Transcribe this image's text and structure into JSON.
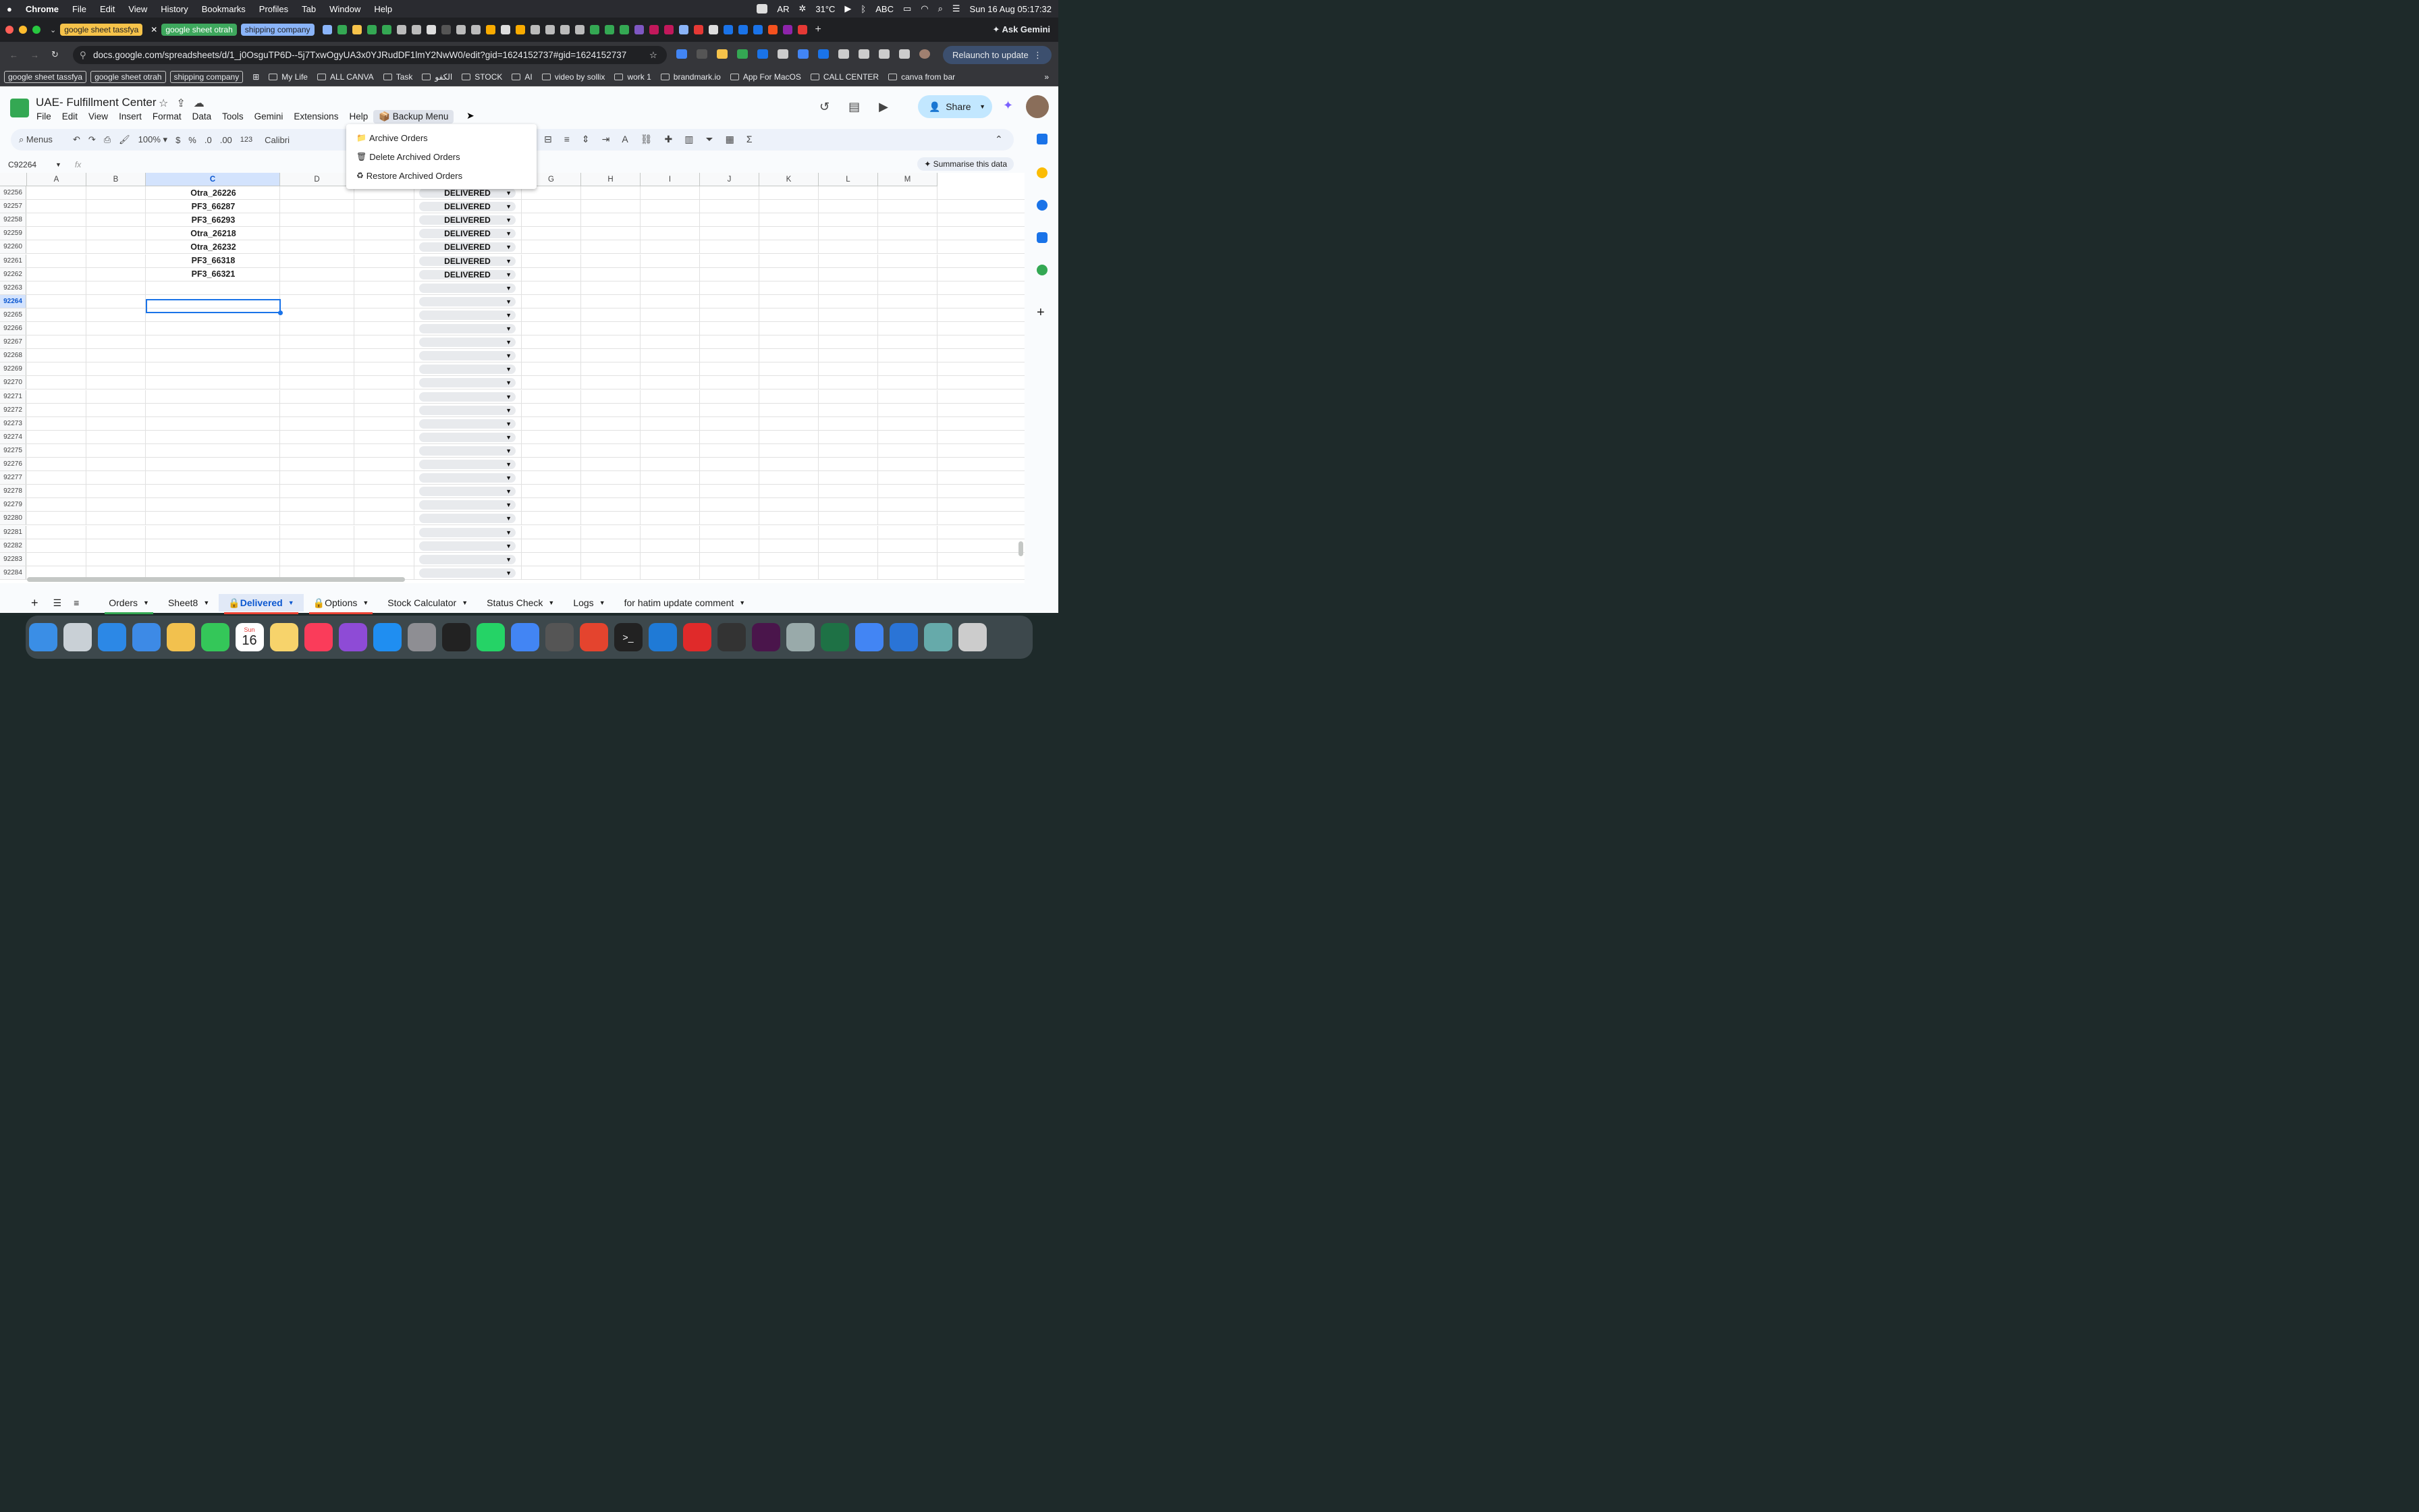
{
  "macbar": {
    "menus": [
      "Chrome",
      "File",
      "Edit",
      "View",
      "History",
      "Bookmarks",
      "Profiles",
      "Tab",
      "Window",
      "Help"
    ],
    "input_lang": "AR",
    "weather": "31°C",
    "kbd_label": "ABC",
    "datetime": "Sun 16 Aug  05:17:32"
  },
  "tabs": {
    "items": [
      {
        "label": "google sheet tassfya",
        "bg": "#f6c34a",
        "fg": "#202124"
      },
      {
        "label": "google sheet otrah",
        "bg": "#3ea85d",
        "fg": "#ffffff"
      },
      {
        "label": "shipping company",
        "bg": "#8ab4f8",
        "fg": "#202124"
      }
    ],
    "gemini": "Ask Gemini"
  },
  "urlbar": {
    "url": "docs.google.com/spreadsheets/d/1_j0OsguTP6D--5j7TxwOgyUA3x0YJRudDF1lmY2NwW0/edit?gid=1624152737#gid=1624152737",
    "relaunch": "Relaunch to update"
  },
  "bookmarks": {
    "pills": [
      "google sheet tassfya",
      "google sheet otrah",
      "shipping company"
    ],
    "items": [
      "My Life",
      "ALL CANVA",
      "Task",
      "الكفو",
      "STOCK",
      "AI",
      "video by sollix",
      "work 1",
      "brandmark.io",
      "App For MacOS",
      "CALL CENTER",
      "canva from bar"
    ]
  },
  "sheets": {
    "title": "UAE- Fulfillment Center",
    "menus": [
      "File",
      "Edit",
      "View",
      "Insert",
      "Format",
      "Data",
      "Tools",
      "Gemini",
      "Extensions",
      "Help"
    ],
    "backup_menu": "Backup Menu",
    "share": "Share",
    "toolbar": {
      "search": "Menus",
      "zoom": "100%",
      "currency": "$",
      "percent": "%",
      "dec_less": ".0",
      "dec_more": ".00",
      "number": "123",
      "font": "Calibri"
    },
    "cell_ref": "C92264",
    "summarise": "Summarise this data",
    "columns": [
      "A",
      "B",
      "C",
      "D",
      "E",
      "F",
      "G",
      "H",
      "I",
      "J",
      "K",
      "L",
      "M"
    ],
    "rows": [
      {
        "n": "92256",
        "c": "Otra_26226",
        "status": "DELIVERED"
      },
      {
        "n": "92257",
        "c": "PF3_66287",
        "status": "DELIVERED"
      },
      {
        "n": "92258",
        "c": "PF3_66293",
        "status": "DELIVERED"
      },
      {
        "n": "92259",
        "c": "Otra_26218",
        "status": "DELIVERED"
      },
      {
        "n": "92260",
        "c": "Otra_26232",
        "status": "DELIVERED"
      },
      {
        "n": "92261",
        "c": "PF3_66318",
        "status": "DELIVERED"
      },
      {
        "n": "92262",
        "c": "PF3_66321",
        "status": "DELIVERED"
      },
      {
        "n": "92263",
        "c": "",
        "status": ""
      },
      {
        "n": "92264",
        "c": "",
        "status": ""
      },
      {
        "n": "92265",
        "c": "",
        "status": ""
      },
      {
        "n": "92266",
        "c": "",
        "status": ""
      },
      {
        "n": "92267",
        "c": "",
        "status": ""
      },
      {
        "n": "92268",
        "c": "",
        "status": ""
      },
      {
        "n": "92269",
        "c": "",
        "status": ""
      },
      {
        "n": "92270",
        "c": "",
        "status": ""
      },
      {
        "n": "92271",
        "c": "",
        "status": ""
      },
      {
        "n": "92272",
        "c": "",
        "status": ""
      },
      {
        "n": "92273",
        "c": "",
        "status": ""
      },
      {
        "n": "92274",
        "c": "",
        "status": ""
      },
      {
        "n": "92275",
        "c": "",
        "status": ""
      },
      {
        "n": "92276",
        "c": "",
        "status": ""
      },
      {
        "n": "92277",
        "c": "",
        "status": ""
      },
      {
        "n": "92278",
        "c": "",
        "status": ""
      },
      {
        "n": "92279",
        "c": "",
        "status": ""
      },
      {
        "n": "92280",
        "c": "",
        "status": ""
      },
      {
        "n": "92281",
        "c": "",
        "status": ""
      },
      {
        "n": "92282",
        "c": "",
        "status": ""
      },
      {
        "n": "92283",
        "c": "",
        "status": ""
      },
      {
        "n": "92284",
        "c": "",
        "status": ""
      }
    ],
    "selected_row": "92264",
    "dropdown": [
      {
        "icon": "folder-icon",
        "glyph": "📁",
        "label": "Archive Orders"
      },
      {
        "icon": "trash-icon",
        "glyph": "🗑",
        "label": "Delete Archived Orders"
      },
      {
        "icon": "recycle-icon",
        "glyph": "♻",
        "label": "Restore Archived Orders"
      }
    ],
    "sheet_tabs": [
      {
        "label": "Orders",
        "color": "#34a853",
        "locked": false,
        "active": false
      },
      {
        "label": "Sheet8",
        "color": "",
        "locked": false,
        "active": false
      },
      {
        "label": "Delivered",
        "color": "#ea4335",
        "locked": true,
        "active": true
      },
      {
        "label": "Options",
        "color": "#ea4335",
        "locked": true,
        "active": false
      },
      {
        "label": "Stock Calculator",
        "color": "",
        "locked": false,
        "active": false
      },
      {
        "label": "Status Check",
        "color": "",
        "locked": false,
        "active": false
      },
      {
        "label": "Logs",
        "color": "",
        "locked": false,
        "active": false
      },
      {
        "label": "for hatim update comment",
        "color": "",
        "locked": false,
        "active": false
      }
    ]
  },
  "dock": {
    "date_day": "Sun",
    "date_num": "16",
    "apps": [
      "finder",
      "launchpad",
      "safari",
      "mail",
      "photos",
      "facetime",
      "calendar",
      "notes",
      "music",
      "podcasts",
      "app-store",
      "system-settings",
      "capcut",
      "whatsapp",
      "chrome",
      "calculator",
      "anydesk",
      "terminal",
      "vscode",
      "acrobat",
      "screen",
      "slack",
      "network",
      "excel",
      "chrome-2",
      "transfer",
      "gallery",
      "trash"
    ]
  }
}
